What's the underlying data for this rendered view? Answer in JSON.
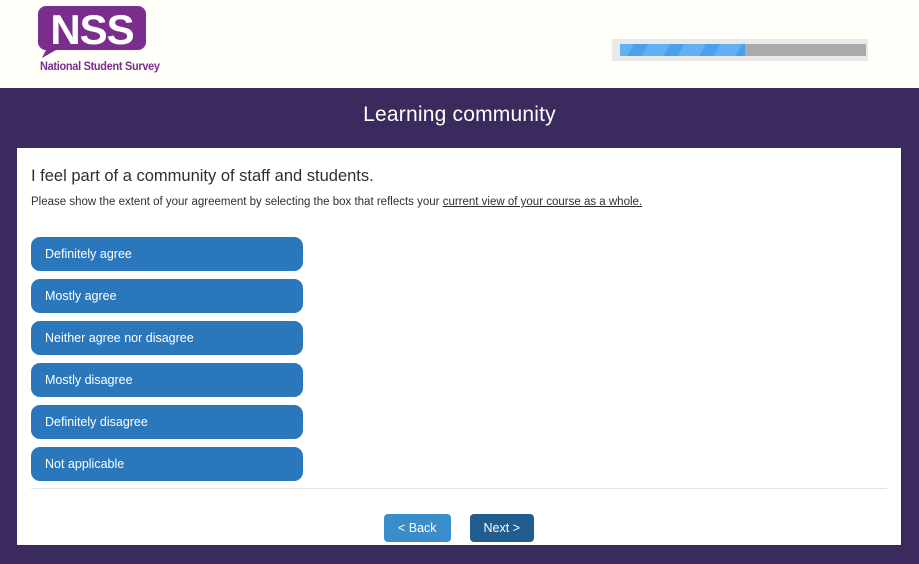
{
  "header": {
    "logo": {
      "acronym": "NSS",
      "subtitle": "National Student Survey",
      "brand_color": "#7b2d8e"
    },
    "progress": {
      "percent": 51,
      "fill_color": "#4ba3ef",
      "track_color": "#aaaaaa"
    }
  },
  "page": {
    "title": "Learning community",
    "background_color": "#3a2a5d"
  },
  "question": {
    "title": "I feel part of a community of staff and students.",
    "instruction_prefix": "Please show the extent of your agreement by selecting the box that reflects your ",
    "instruction_link": "current view of your course as a whole.",
    "options": [
      {
        "label": "Definitely agree"
      },
      {
        "label": "Mostly agree"
      },
      {
        "label": "Neither agree nor disagree"
      },
      {
        "label": "Mostly disagree"
      },
      {
        "label": "Definitely disagree"
      },
      {
        "label": "Not applicable"
      }
    ],
    "option_color": "#2b77bb"
  },
  "nav": {
    "back_label": "< Back",
    "next_label": "Next >",
    "back_color": "#3a8dc8",
    "next_color": "#215d8f"
  }
}
